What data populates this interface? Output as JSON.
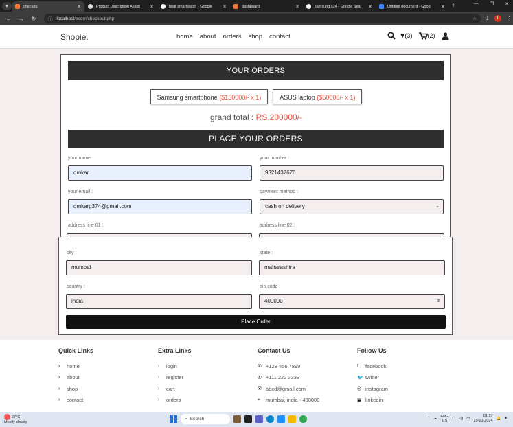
{
  "browser": {
    "tabs": [
      {
        "title": "checkout",
        "color": "#f07b3f",
        "active": true
      },
      {
        "title": "Product Description Assist",
        "color": "#dddddd",
        "active": false
      },
      {
        "title": "boat smartwatch - Google",
        "color": "#ffffff",
        "active": false
      },
      {
        "title": "dashboard",
        "color": "#f07b3f",
        "active": false
      },
      {
        "title": "samsung s24 - Google Sea",
        "color": "#ffffff",
        "active": false
      },
      {
        "title": "Untitled document - Goog",
        "color": "#4285f4",
        "active": false
      }
    ],
    "url_host": "localhost",
    "url_path": "/ecom/checkout.php",
    "profile_initial": "T"
  },
  "site": {
    "logo": "Shopie.",
    "nav": [
      "home",
      "about",
      "orders",
      "shop",
      "contact"
    ],
    "wishlist_count": "(3)",
    "cart_count": "(2)"
  },
  "orders": {
    "heading": "YOUR ORDERS",
    "items": [
      {
        "name": "Samsung smartphone",
        "price": "($150000/- x 1)"
      },
      {
        "name": "ASUS laptop",
        "price": "($50000/- x 1)"
      }
    ],
    "grand_label": "grand total : ",
    "grand_amount": "RS.200000/-"
  },
  "form": {
    "heading": "PLACE YOUR ORDERS",
    "name_label": "your name :",
    "name_value": "omkar",
    "number_label": "your number :",
    "number_value": "9321437676",
    "email_label": "your email :",
    "email_value": "omkarg374@gmail.com",
    "payment_label": "payment method :",
    "payment_value": "cash on delivery",
    "addr1_label": "address line 01 :",
    "addr2_label": "address line 02 :",
    "city_label": "city :",
    "city_value": "mumbai",
    "state_label": "state :",
    "state_value": "maharashtra",
    "country_label": "country :",
    "country_value": "india",
    "pin_label": "pin code :",
    "pin_value": "400000",
    "submit": "Place Order"
  },
  "footer": {
    "quick": {
      "title": "Quick Links",
      "links": [
        "home",
        "about",
        "shop",
        "contact"
      ]
    },
    "extra": {
      "title": "Extra Links",
      "links": [
        "login",
        "register",
        "cart",
        "orders"
      ]
    },
    "contact": {
      "title": "Contact Us",
      "items": [
        "+123 456 7899",
        "+111 222 3333",
        "abcd@gmail.com",
        "mumbai, india - 400000"
      ]
    },
    "follow": {
      "title": "Follow Us",
      "items": [
        "facebook",
        "twitter",
        "instagram",
        "linkedin"
      ]
    }
  },
  "taskbar": {
    "weather_temp": "27°C",
    "weather_desc": "Mostly cloudy",
    "search": "Search",
    "lang_top": "ENG",
    "lang_bottom": "US",
    "time": "01:17",
    "date": "15-10-2024"
  }
}
